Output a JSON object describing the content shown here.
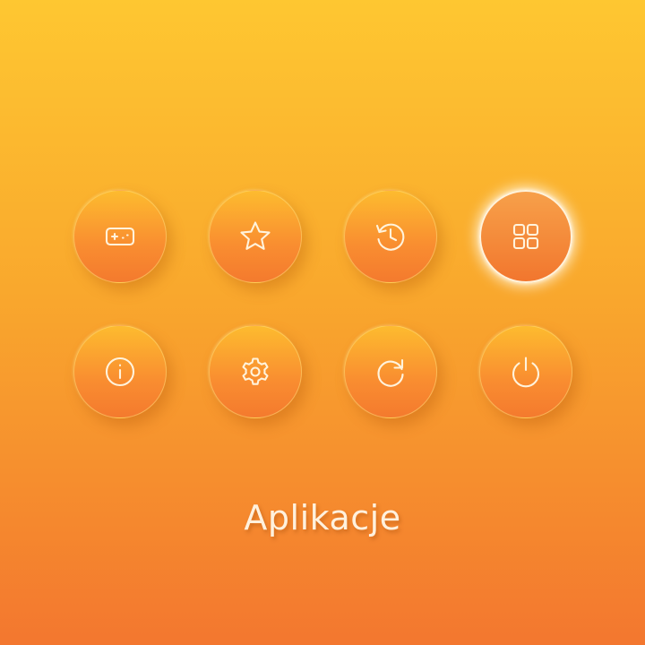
{
  "menu": {
    "items": [
      {
        "name": "games",
        "icon": "gamepad-icon",
        "active": false
      },
      {
        "name": "favorites",
        "icon": "star-icon",
        "active": false
      },
      {
        "name": "history",
        "icon": "history-icon",
        "active": false
      },
      {
        "name": "apps",
        "icon": "grid-icon",
        "active": true
      },
      {
        "name": "info",
        "icon": "info-icon",
        "active": false
      },
      {
        "name": "settings",
        "icon": "gear-icon",
        "active": false
      },
      {
        "name": "refresh",
        "icon": "refresh-icon",
        "active": false
      },
      {
        "name": "power",
        "icon": "power-icon",
        "active": false
      }
    ],
    "selected_label": "Aplikacje"
  },
  "colors": {
    "background_top": "#fec731",
    "background_bottom": "#f3772f",
    "icon_stroke": "#fff3dc",
    "label_text": "#fff1dd"
  }
}
